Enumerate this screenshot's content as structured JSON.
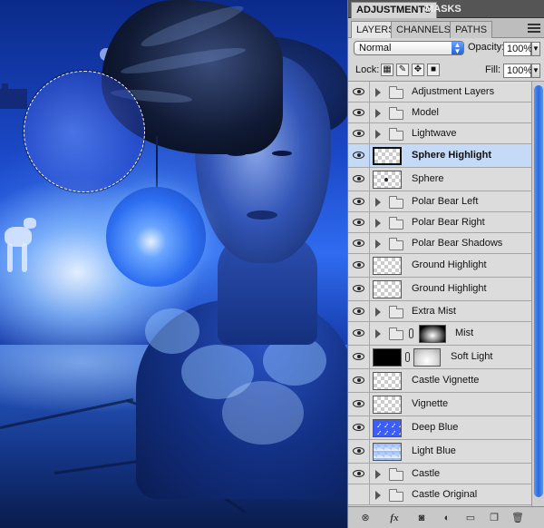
{
  "top_tabs": [
    {
      "label": "ADJUSTMENTS",
      "active": true
    },
    {
      "label": "MASKS",
      "active": false
    }
  ],
  "sub_tabs": [
    {
      "label": "LAYERS",
      "active": true
    },
    {
      "label": "CHANNELS",
      "active": false
    },
    {
      "label": "PATHS",
      "active": false
    }
  ],
  "options": {
    "blend_mode": "Normal",
    "opacity_label": "Opacity:",
    "opacity_value": "100%",
    "lock_label": "Lock:",
    "fill_label": "Fill:",
    "fill_value": "100%"
  },
  "layers": [
    {
      "name": "Adjustment Layers",
      "kind": "group",
      "visible": true
    },
    {
      "name": "Model",
      "kind": "group",
      "visible": true
    },
    {
      "name": "Lightwave",
      "kind": "group",
      "visible": true
    },
    {
      "name": "Sphere Highlight",
      "kind": "layer",
      "visible": true,
      "selected": true
    },
    {
      "name": "Sphere",
      "kind": "layer",
      "visible": true
    },
    {
      "name": "Polar Bear Left",
      "kind": "group",
      "visible": true
    },
    {
      "name": "Polar Bear Right",
      "kind": "group",
      "visible": true
    },
    {
      "name": "Polar Bear Shadows",
      "kind": "group",
      "visible": true
    },
    {
      "name": "Ground Highlight",
      "kind": "layer",
      "visible": true
    },
    {
      "name": "Ground Highlight",
      "kind": "layer",
      "visible": true
    },
    {
      "name": "Extra Mist",
      "kind": "group",
      "visible": true
    },
    {
      "name": "Mist",
      "kind": "group-mask",
      "visible": true
    },
    {
      "name": "Soft Light",
      "kind": "layer-mask",
      "visible": true
    },
    {
      "name": "Castle Vignette",
      "kind": "layer",
      "visible": true
    },
    {
      "name": "Vignette",
      "kind": "layer",
      "visible": true
    },
    {
      "name": "Deep Blue",
      "kind": "layer",
      "visible": true
    },
    {
      "name": "Light Blue",
      "kind": "layer",
      "visible": true
    },
    {
      "name": "Castle",
      "kind": "group",
      "visible": true
    },
    {
      "name": "Castle Original",
      "kind": "group",
      "visible": false
    }
  ],
  "footer_icons": [
    "link-icon",
    "fx-icon",
    "add-mask-icon",
    "adjustment-icon",
    "new-group-icon",
    "new-layer-icon",
    "trash-icon"
  ],
  "footer_fx_label": "fx",
  "colors": {
    "selected_row": "#c4daf6",
    "scrollbar": "#2a6be0"
  }
}
